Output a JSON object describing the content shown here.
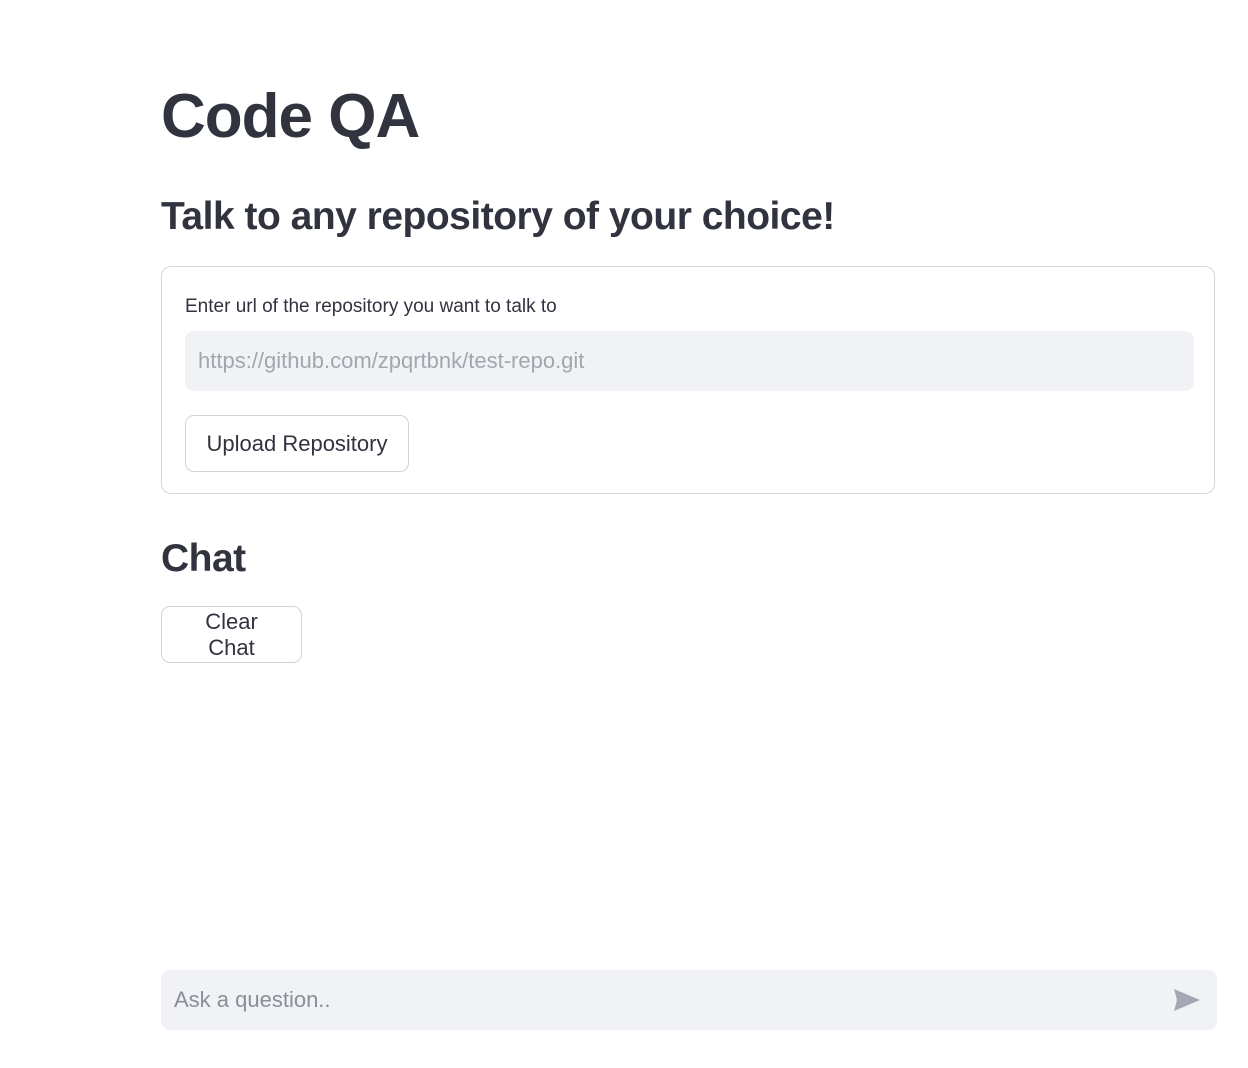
{
  "header": {
    "title": "Code QA",
    "subtitle": "Talk to any repository of your choice!"
  },
  "repo_form": {
    "label": "Enter url of the repository you want to talk to",
    "url_value": "",
    "url_placeholder": "https://github.com/zpqrtbnk/test-repo.git",
    "upload_button_label": "Upload Repository"
  },
  "chat": {
    "heading": "Chat",
    "clear_button_label": "Clear Chat",
    "input_value": "",
    "input_placeholder": "Ask a question..",
    "send_icon": "send-icon"
  },
  "colors": {
    "text": "#31333f",
    "input_bg": "#f0f2f6",
    "border": "#d6d6d9",
    "placeholder": "#a3a6ad",
    "send_icon": "#a3a8b4"
  }
}
